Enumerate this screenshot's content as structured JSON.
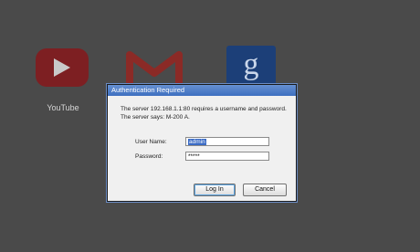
{
  "background_tiles": {
    "youtube_label": "YouTube"
  },
  "dialog": {
    "title": "Authentication Required",
    "message_line1": "The server 192.168.1.1:80 requires a username and password.",
    "message_line2": "The server says: M-200 A.",
    "username_label": "User Name:",
    "username_value": "admin",
    "password_label": "Password:",
    "password_value": "*****",
    "login_label": "Log In",
    "cancel_label": "Cancel"
  },
  "colors": {
    "backdrop": "#4a4a4a",
    "titlebar": "#4f7fc9",
    "youtube_tile": "#7d1f22",
    "google_tile": "#1c3f78"
  }
}
